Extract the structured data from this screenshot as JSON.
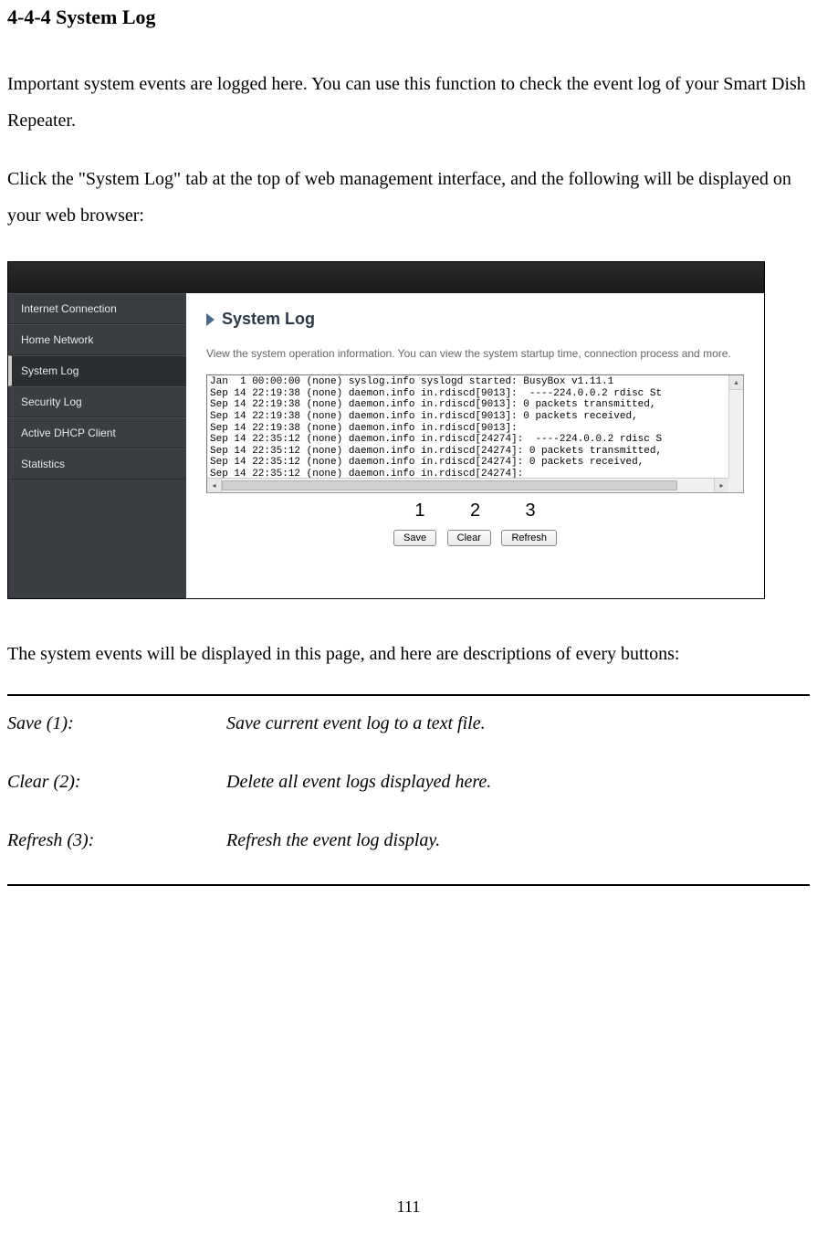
{
  "heading": "4-4-4 System Log",
  "para1": "Important system events are logged here. You can use this function to check the event log of your Smart Dish Repeater.",
  "para2": "Click the \"System Log\" tab at the top of web management interface, and the following will be displayed on your web browser:",
  "screenshot": {
    "nav": [
      "Internet Connection",
      "Home Network",
      "System Log",
      "Security Log",
      "Active DHCP Client",
      "Statistics"
    ],
    "title": "System Log",
    "desc": "View the system operation information. You can view the system startup time, connection process and more.",
    "log_lines": "Jan  1 00:00:00 (none) syslog.info syslogd started: BusyBox v1.11.1\nSep 14 22:19:38 (none) daemon.info in.rdiscd[9013]:  ----224.0.0.2 rdisc St\nSep 14 22:19:38 (none) daemon.info in.rdiscd[9013]: 0 packets transmitted,\nSep 14 22:19:38 (none) daemon.info in.rdiscd[9013]: 0 packets received,\nSep 14 22:19:38 (none) daemon.info in.rdiscd[9013]:\nSep 14 22:35:12 (none) daemon.info in.rdiscd[24274]:  ----224.0.0.2 rdisc S\nSep 14 22:35:12 (none) daemon.info in.rdiscd[24274]: 0 packets transmitted,\nSep 14 22:35:12 (none) daemon.info in.rdiscd[24274]: 0 packets received,\nSep 14 22:35:12 (none) daemon.info in.rdiscd[24274]:",
    "callouts": {
      "n1": "1",
      "n2": "2",
      "n3": "3"
    },
    "buttons": {
      "save": "Save",
      "clear": "Clear",
      "refresh": "Refresh"
    }
  },
  "para3": "The system events will be displayed in this page, and here are descriptions of every buttons:",
  "descriptions": [
    {
      "label": "Save (1):",
      "text": "Save current event log to a text file."
    },
    {
      "label": "Clear (2):",
      "text": "Delete all event logs displayed here."
    },
    {
      "label": "Refresh (3):",
      "text": "Refresh the event log display."
    }
  ],
  "page_number": "111"
}
